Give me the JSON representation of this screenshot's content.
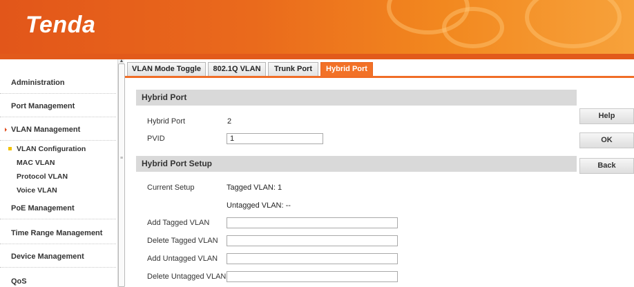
{
  "header": {
    "logo": "Tenda"
  },
  "sidebar": {
    "items": [
      {
        "label": "Administration"
      },
      {
        "label": "Port Management"
      },
      {
        "label": "VLAN Management"
      },
      {
        "label": "PoE Management"
      },
      {
        "label": "Time Range Management"
      },
      {
        "label": "Device Management"
      },
      {
        "label": "QoS"
      }
    ],
    "sub_items": [
      {
        "label": "VLAN Configuration"
      },
      {
        "label": "MAC VLAN"
      },
      {
        "label": "Protocol VLAN"
      },
      {
        "label": "Voice VLAN"
      }
    ]
  },
  "tabs": [
    {
      "label": "VLAN Mode Toggle"
    },
    {
      "label": "802.1Q VLAN"
    },
    {
      "label": "Trunk Port"
    },
    {
      "label": "Hybrid Port"
    }
  ],
  "hybrid_port": {
    "title": "Hybrid Port",
    "port_label": "Hybrid Port",
    "port_value": "2",
    "pvid_label": "PVID",
    "pvid_value": "1"
  },
  "setup": {
    "title": "Hybrid Port Setup",
    "current_setup_label": "Current Setup",
    "tagged_vlan_text": "Tagged VLAN: 1",
    "untagged_vlan_text": "Untagged VLAN: --",
    "add_tagged_label": "Add Tagged VLAN",
    "add_tagged_value": "",
    "delete_tagged_label": "Delete Tagged VLAN",
    "delete_tagged_value": "",
    "add_untagged_label": "Add Untagged VLAN",
    "add_untagged_value": "",
    "delete_untagged_label": "Delete Untagged VLAN",
    "delete_untagged_value": ""
  },
  "buttons": {
    "help": "Help",
    "ok": "OK",
    "back": "Back"
  },
  "colors": {
    "brand_orange": "#f06d26",
    "active_tab": "#f27127",
    "section_bg": "#d9d9d9"
  }
}
